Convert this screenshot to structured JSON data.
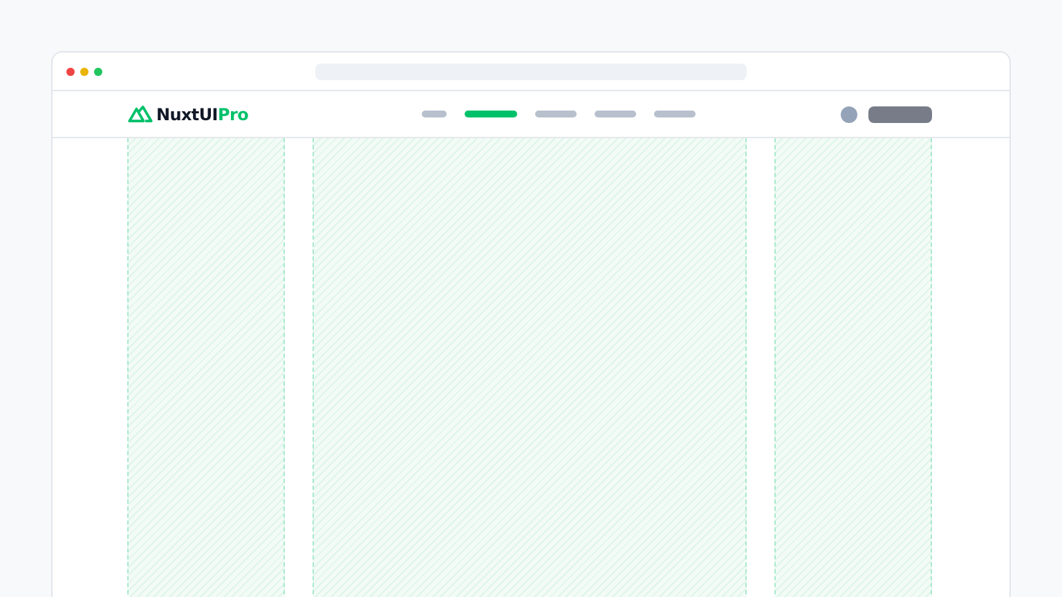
{
  "header": {
    "logo": {
      "brand": "NuxtUI",
      "suffix": "Pro"
    },
    "nav": [
      {
        "selected": false
      },
      {
        "selected": true
      },
      {
        "selected": false
      },
      {
        "selected": false
      },
      {
        "selected": false
      }
    ]
  }
}
